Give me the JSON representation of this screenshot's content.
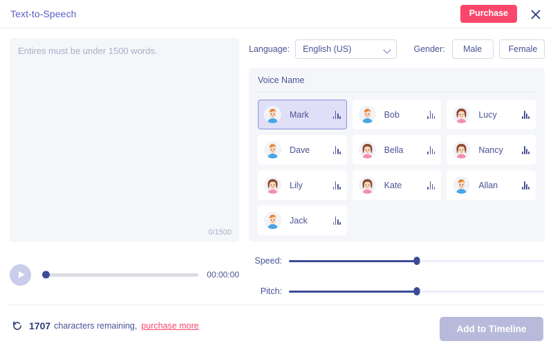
{
  "header": {
    "title": "Text-to-Speech",
    "purchase_label": "Purchase",
    "close_icon": "close-icon"
  },
  "editor": {
    "placeholder": "Entires must be under 1500 words.",
    "value": "",
    "counter": "0/1500"
  },
  "player": {
    "play_icon": "play-icon",
    "progress_percent": 0,
    "time": "00:00:00"
  },
  "controls": {
    "language_label": "Language:",
    "language_value": "English (US)",
    "language_options": [
      "English (US)"
    ],
    "chevron_icon": "chevron-down-icon",
    "gender_label": "Gender:",
    "gender_male": "Male",
    "gender_female": "Female"
  },
  "voice_panel": {
    "title": "Voice Name",
    "voices": [
      {
        "name": "Mark",
        "gender": "male",
        "selected": true
      },
      {
        "name": "Bob",
        "gender": "male",
        "selected": false
      },
      {
        "name": "Lucy",
        "gender": "female",
        "selected": false
      },
      {
        "name": "Dave",
        "gender": "male",
        "selected": false
      },
      {
        "name": "Bella",
        "gender": "female",
        "selected": false
      },
      {
        "name": "Nancy",
        "gender": "female",
        "selected": false
      },
      {
        "name": "Lily",
        "gender": "female",
        "selected": false
      },
      {
        "name": "Kate",
        "gender": "female",
        "selected": false
      },
      {
        "name": "Allan",
        "gender": "male",
        "selected": false
      },
      {
        "name": "Jack",
        "gender": "male",
        "selected": false
      }
    ]
  },
  "sliders": {
    "speed_label": "Speed:",
    "speed_percent": 50,
    "pitch_label": "Pitch:",
    "pitch_percent": 50
  },
  "footer": {
    "refresh_icon": "refresh-icon",
    "chars_remaining": "1707",
    "chars_text": "characters remaining,",
    "purchase_more": "purchase more",
    "add_timeline": "Add to Timeline"
  },
  "colors": {
    "accent_pink": "#f8476a",
    "accent_purple": "#5b5fc7",
    "text_indigo": "#4a5396",
    "panel_bg": "#f5f6fa",
    "selected_bg": "#dfdff7",
    "selected_border": "#8a8fdb",
    "disabled_button": "#b7bada",
    "slider_fill": "#3c4a97"
  }
}
